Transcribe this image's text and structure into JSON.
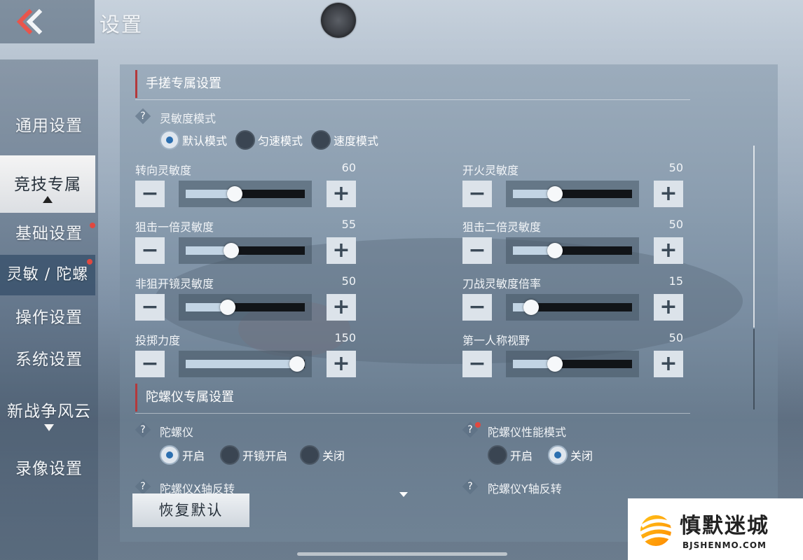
{
  "header": {
    "back_icon": "double-chevron-left-icon",
    "title": "设置"
  },
  "sidebar": {
    "items": [
      {
        "label": "通用设置",
        "state": "normal"
      },
      {
        "label": "竞技专属",
        "state": "selected"
      },
      {
        "label": "基础设置",
        "state": "normal",
        "badge": "red-dot"
      },
      {
        "label": "灵敏 / 陀螺",
        "state": "highlighted",
        "badge": "red-dot"
      },
      {
        "label": "操作设置",
        "state": "normal"
      },
      {
        "label": "系统设置",
        "state": "normal"
      },
      {
        "label": "新战争风云",
        "state": "normal"
      },
      {
        "label": "录像设置",
        "state": "normal"
      }
    ]
  },
  "handheld": {
    "title": "手搓专属设置",
    "mode_label": "灵敏度模式",
    "mode_options": [
      "默认模式",
      "匀速模式",
      "速度模式"
    ],
    "mode_selected": "默认模式",
    "sliders": [
      {
        "label": "转向灵敏度",
        "value": 60,
        "max": 150
      },
      {
        "label": "开火灵敏度",
        "value": 50,
        "max": 150
      },
      {
        "label": "狙击一倍灵敏度",
        "value": 55,
        "max": 150
      },
      {
        "label": "狙击二倍灵敏度",
        "value": 50,
        "max": 150
      },
      {
        "label": "非狙开镜灵敏度",
        "value": 50,
        "max": 150
      },
      {
        "label": "刀战灵敏度倍率",
        "value": 15,
        "max": 150
      },
      {
        "label": "投掷力度",
        "value": 150,
        "max": 150
      },
      {
        "label": "第一人称视野",
        "value": 50,
        "max": 150
      }
    ]
  },
  "gyro": {
    "title": "陀螺仪专属设置",
    "gyro_label": "陀螺仪",
    "gyro_options": [
      "开启",
      "开镜开启",
      "关闭"
    ],
    "gyro_selected": "开启",
    "perf_label": "陀螺仪性能模式",
    "perf_options": [
      "开启",
      "关闭"
    ],
    "perf_selected": "关闭",
    "x_invert_label": "陀螺仪X轴反转",
    "y_invert_label": "陀螺仪Y轴反转"
  },
  "footer": {
    "restore_label": "恢复默认"
  },
  "watermark": {
    "title": "慎默迷城",
    "subtitle": "BJSHENMO.COM"
  },
  "colors": {
    "accent_red": "#b3393c",
    "badge_red": "#e1483f",
    "radio_on": "#2c6fb0",
    "slider_fill": "#c2d4e4"
  }
}
